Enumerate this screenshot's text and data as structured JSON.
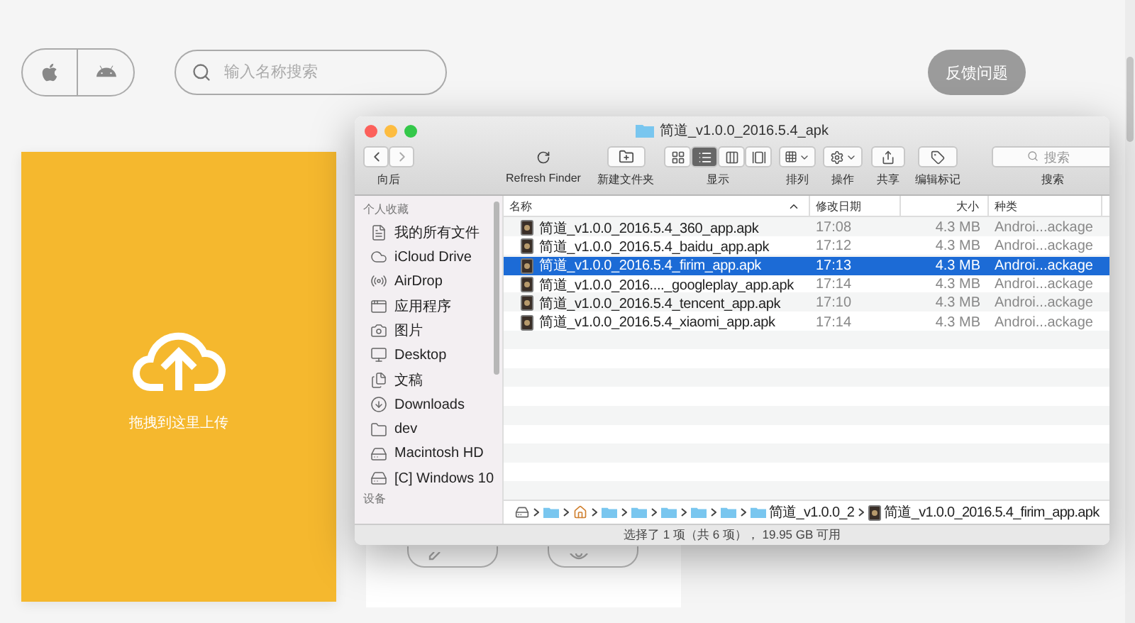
{
  "top_bar": {
    "platforms": [
      {
        "kind": "apple",
        "selected": false
      },
      {
        "kind": "android",
        "selected": false
      }
    ],
    "search": {
      "placeholder": "输入名称搜索"
    },
    "feedback_button": "反馈问题"
  },
  "upload_card": {
    "text": "拖拽到这里上传"
  },
  "preview_card": {
    "buttons": [
      {
        "kind": "edit"
      },
      {
        "kind": "preview"
      }
    ]
  },
  "finder": {
    "title": "简道_v1.0.0_2016.5.4_apk",
    "toolbar": {
      "back_label": "向后",
      "refresh_label": "Refresh Finder",
      "new_folder_label": "新建文件夹",
      "view_label": "显示",
      "view_modes": [
        {
          "kind": "icons",
          "selected": false
        },
        {
          "kind": "list",
          "selected": true
        },
        {
          "kind": "columns",
          "selected": false
        },
        {
          "kind": "coverflow",
          "selected": false
        }
      ],
      "arrange_label": "排列",
      "action_label": "操作",
      "share_label": "共享",
      "tags_label": "编辑标记",
      "search_placeholder": "搜索",
      "search_label": "搜索"
    },
    "sidebar": {
      "section": "个人收藏",
      "items": [
        {
          "label": "我的所有文件",
          "kind": "allfiles"
        },
        {
          "label": "iCloud Drive",
          "kind": "cloud"
        },
        {
          "label": "AirDrop",
          "kind": "airdrop"
        },
        {
          "label": "应用程序",
          "kind": "apps"
        },
        {
          "label": "图片",
          "kind": "camera"
        },
        {
          "label": "Desktop",
          "kind": "desktop"
        },
        {
          "label": "文稿",
          "kind": "documents"
        },
        {
          "label": "Downloads",
          "kind": "downloads"
        },
        {
          "label": "dev",
          "kind": "folder"
        },
        {
          "label": "Macintosh HD",
          "kind": "disk"
        },
        {
          "label": "[C] Windows 10",
          "kind": "disk"
        }
      ],
      "footer_section": "设备"
    },
    "columns": [
      {
        "label": "名称",
        "sorted": true
      },
      {
        "label": "修改日期",
        "sorted": false
      },
      {
        "label": "大小",
        "sorted": false
      },
      {
        "label": "种类",
        "sorted": false
      }
    ],
    "files": [
      {
        "name": "简道_v1.0.0_2016.5.4_360_app.apk",
        "date": "17:08",
        "size": "4.3 MB",
        "kind": "Androi...ackage",
        "selected": false
      },
      {
        "name": "简道_v1.0.0_2016.5.4_baidu_app.apk",
        "date": "17:12",
        "size": "4.3 MB",
        "kind": "Androi...ackage",
        "selected": false
      },
      {
        "name": "简道_v1.0.0_2016.5.4_firim_app.apk",
        "date": "17:13",
        "size": "4.3 MB",
        "kind": "Androi...ackage",
        "selected": true
      },
      {
        "name": "简道_v1.0.0_2016...._googleplay_app.apk",
        "date": "17:14",
        "size": "4.3 MB",
        "kind": "Androi...ackage",
        "selected": false
      },
      {
        "name": "简道_v1.0.0_2016.5.4_tencent_app.apk",
        "date": "17:10",
        "size": "4.3 MB",
        "kind": "Androi...ackage",
        "selected": false
      },
      {
        "name": "简道_v1.0.0_2016.5.4_xiaomi_app.apk",
        "date": "17:14",
        "size": "4.3 MB",
        "kind": "Androi...ackage",
        "selected": false
      }
    ],
    "path": [
      {
        "kind": "disk"
      },
      {
        "kind": "user"
      },
      {
        "kind": "home"
      },
      {
        "kind": "folder"
      },
      {
        "kind": "folder"
      },
      {
        "kind": "folder"
      },
      {
        "kind": "folder"
      },
      {
        "kind": "folder"
      },
      {
        "kind": "folder",
        "label": "简道_v1.0.0_2"
      },
      {
        "kind": "file",
        "label": "简道_v1.0.0_2016.5.4_firim_app.apk"
      }
    ],
    "status": "选择了 1 项（共 6 项）， 19.95 GB 可用"
  }
}
